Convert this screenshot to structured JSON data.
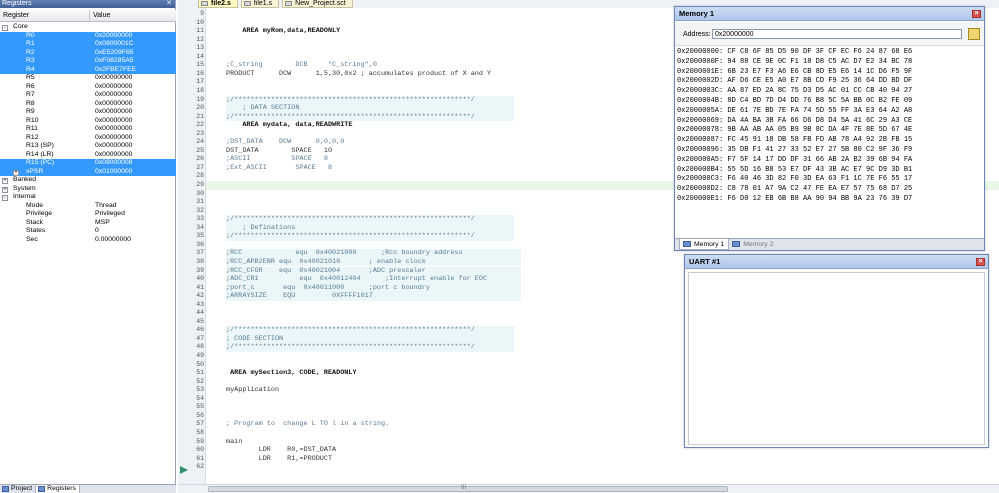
{
  "registers": {
    "title": "Registers",
    "col_register": "Register",
    "col_value": "Value",
    "rows": [
      {
        "name": "Core",
        "value": "",
        "group": true,
        "twisty": "-",
        "selected": false
      },
      {
        "name": "R0",
        "value": "0x20000000",
        "selected": true
      },
      {
        "name": "R1",
        "value": "0x0800001C",
        "selected": true
      },
      {
        "name": "R2",
        "value": "0xE5209F65",
        "selected": true
      },
      {
        "name": "R3",
        "value": "0xF08285A5",
        "selected": true
      },
      {
        "name": "R4",
        "value": "0x2FBE7FEE",
        "selected": true
      },
      {
        "name": "R5",
        "value": "0x00000000",
        "selected": false
      },
      {
        "name": "R6",
        "value": "0x00000000",
        "selected": false
      },
      {
        "name": "R7",
        "value": "0x00000000",
        "selected": false
      },
      {
        "name": "R8",
        "value": "0x00000000",
        "selected": false
      },
      {
        "name": "R9",
        "value": "0x00000000",
        "selected": false
      },
      {
        "name": "R10",
        "value": "0x00000000",
        "selected": false
      },
      {
        "name": "R11",
        "value": "0x00000000",
        "selected": false
      },
      {
        "name": "R12",
        "value": "0x00000000",
        "selected": false
      },
      {
        "name": "R13 (SP)",
        "value": "0x00000000",
        "selected": false
      },
      {
        "name": "R14 (LR)",
        "value": "0x00000000",
        "selected": false
      },
      {
        "name": "R15 (PC)",
        "value": "0x08000008",
        "selected": true
      },
      {
        "name": "xPSR",
        "value": "0x01000000",
        "selected": true,
        "twisty": "+"
      },
      {
        "name": "Banked",
        "value": "",
        "group": true,
        "twisty": "+",
        "selected": false
      },
      {
        "name": "System",
        "value": "",
        "group": true,
        "twisty": "+",
        "selected": false
      },
      {
        "name": "Internal",
        "value": "",
        "group": true,
        "twisty": "-",
        "selected": false
      },
      {
        "name": "Mode",
        "value": "Thread",
        "selected": false
      },
      {
        "name": "Privilege",
        "value": "Privileged",
        "selected": false
      },
      {
        "name": "Stack",
        "value": "MSP",
        "selected": false
      },
      {
        "name": "States",
        "value": "0",
        "selected": false
      },
      {
        "name": "Sec",
        "value": "0.00000000",
        "selected": false
      }
    ],
    "tabs": [
      "Project",
      "Registers"
    ]
  },
  "editor": {
    "tabs": [
      "file2.s",
      "file1.s",
      "New_Project.sct"
    ],
    "active_tab": 0,
    "lines": [
      {
        "n": "9",
        "t": ""
      },
      {
        "n": "10",
        "t": ""
      },
      {
        "n": "11",
        "t": "    AREA myRom,data,READONLY"
      },
      {
        "n": "12",
        "t": ""
      },
      {
        "n": "13",
        "t": ""
      },
      {
        "n": "14",
        "t": ""
      },
      {
        "n": "15",
        "t": ";C_string        DCB     \"C_string\",0"
      },
      {
        "n": "16",
        "t": "PRODUCT      DCW      1,5,30,0x2 ; accumulates product of X and Y"
      },
      {
        "n": "17",
        "t": ""
      },
      {
        "n": "18",
        "t": ""
      },
      {
        "n": "19",
        "t": ";/**********************************************************/"
      },
      {
        "n": "20",
        "t": "    ; DATA SECTION"
      },
      {
        "n": "21",
        "t": ";/**********************************************************/"
      },
      {
        "n": "22",
        "t": "    AREA mydata, data,READWRITE"
      },
      {
        "n": "23",
        "t": ""
      },
      {
        "n": "24",
        "t": ";DST_DATA    DCW      0,0,0,0"
      },
      {
        "n": "25",
        "t": "DST_DATA        SPACE   10"
      },
      {
        "n": "26",
        "t": ";ASCII          SPACE   8"
      },
      {
        "n": "27",
        "t": ";Ext_ASCII       SPACE   8"
      },
      {
        "n": "28",
        "t": ""
      },
      {
        "n": "29",
        "t": ""
      },
      {
        "n": "30",
        "t": ""
      },
      {
        "n": "31",
        "t": ""
      },
      {
        "n": "32",
        "t": ""
      },
      {
        "n": "33",
        "t": ";/**********************************************************/"
      },
      {
        "n": "34",
        "t": "    ; Definations"
      },
      {
        "n": "35",
        "t": ";/**********************************************************/"
      },
      {
        "n": "36",
        "t": ""
      },
      {
        "n": "37",
        "t": ";RCC             equ  0x40021000      ;Rcc boundry address"
      },
      {
        "n": "38",
        "t": ";RCC_APB2ENR equ  0x40021018       ; enable clock"
      },
      {
        "n": "39",
        "t": ";RCC_CFGR    equ  0x40021004       ;ADC prescaler"
      },
      {
        "n": "40",
        "t": ";ADC_CR1          equ  0x40012404      ;Interrupt enable for EOC"
      },
      {
        "n": "41",
        "t": ";port_c       equ  0x40011000      ;port c boundry"
      },
      {
        "n": "42",
        "t": ";ARRAYSIZE    EQU         0XFFFF1017"
      },
      {
        "n": "43",
        "t": ""
      },
      {
        "n": "44",
        "t": ""
      },
      {
        "n": "45",
        "t": ""
      },
      {
        "n": "46",
        "t": ";/**********************************************************/"
      },
      {
        "n": "47",
        "t": "; CODE SECTION"
      },
      {
        "n": "48",
        "t": ";/**********************************************************/"
      },
      {
        "n": "49",
        "t": ""
      },
      {
        "n": "50",
        "t": ""
      },
      {
        "n": "51",
        "t": " AREA mySection3, CODE, READONLY"
      },
      {
        "n": "52",
        "t": ""
      },
      {
        "n": "53",
        "t": "myApplication"
      },
      {
        "n": "54",
        "t": ""
      },
      {
        "n": "55",
        "t": ""
      },
      {
        "n": "56",
        "t": ""
      },
      {
        "n": "57",
        "t": "; Program to  change L TO l in a string."
      },
      {
        "n": "58",
        "t": ""
      },
      {
        "n": "59",
        "t": "main"
      },
      {
        "n": "60",
        "t": "        LDR    R0,=DST_DATA"
      },
      {
        "n": "61",
        "t": "        LDR    R1,=PRODUCT"
      },
      {
        "n": "62",
        "t": ""
      }
    ],
    "highlight_line": "29",
    "hscroll_marker": "III"
  },
  "memory": {
    "title": "Memory 1",
    "address_label": "Address:",
    "address_value": "0x20000000",
    "rows": [
      "0x20000000: CF C8 6F 85 D5 90 DF 3F CF EC F6 24 87 68 E6",
      "0x2000000F: 94 88 CE 9E 0C F1 18 D8 C5 AC D7 E2 34 BC 78",
      "0x2000001E: 6B 23 E7 F3 A6 E6 CB 8D E5 E6 14 1C D6 F5 9F",
      "0x2000002D: AF D6 CE E5 A0 E7 8B CD F9 25 36 64 DD BD DF",
      "0x2000003C: AA 87 ED 2A 8C 75 D3 D5 AC 01 CC CB 40 94 27",
      "0x2000004B: 8D C4 BD 7D D4 DD 76 B8 5C 5A BB 0C B2 FE 09",
      "0x2000005A: DE 61 7E BD 7E FA 74 5D 55 FF 3A E3 64 A2 A8",
      "0x20000069: DA 4A BA 3B FA 66 D6 D8 D4 5A 41 6C 29 A3 CE",
      "0x20000078: 9B AA AB AA 05 B9 9B 8C DA 4F 7E 8E 5D 67 4E",
      "0x20000087: FC 45 91 18 DB 58 FB FD AB 78 A4 92 2B FB 15",
      "0x20000096: 35 DB F1 41 27 33 52 E7 27 5B 80 C2 9F 36 F9",
      "0x200000A5: F7 5F 14 17 DD DF 31 66 AB 2A B2 39 6B 94 FA",
      "0x200000B4: 55 5D 16 B8 53 E7 DF 43 3B AC E7 9C D9 3D B1",
      "0x200000C3: F6 40 46 3D 82 F0 3D EA 63 F1 1C 7E F6 55 17",
      "0x200000D2: C8 78 01 A7 9A C2 47 FE EA E7 57 75 68 D7 25",
      "0x200000E1: F6 D0 12 EB 6B B8 AA 90 94 BB 9A 23 76 39 D7"
    ],
    "tabs": [
      "Memory 1",
      "Memory 2"
    ]
  },
  "uart": {
    "title": "UART #1",
    "content": ""
  },
  "colors": {
    "selection": "#3399ff",
    "highlight_line": "#e9f7e9",
    "window_title": "#aec6ea"
  }
}
